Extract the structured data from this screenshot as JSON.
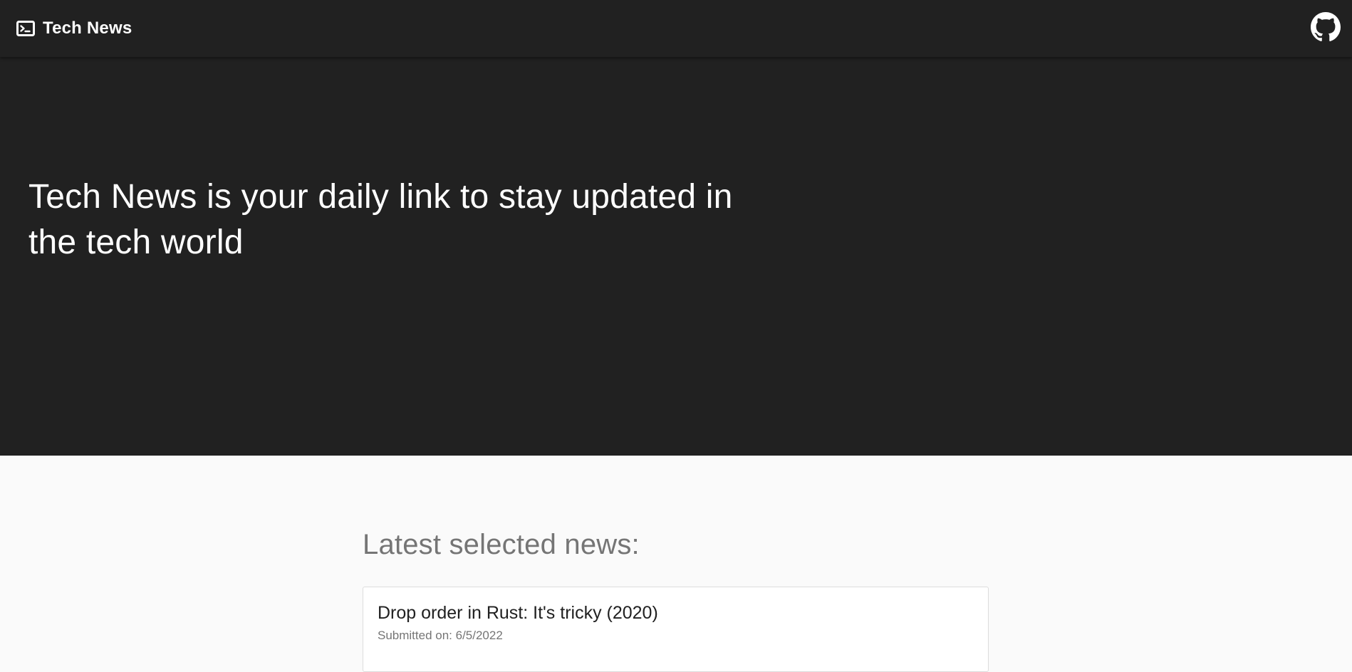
{
  "header": {
    "brand_icon": "terminal-icon",
    "title": "Tech News",
    "github_icon": "github-icon"
  },
  "hero": {
    "text": "Tech News is your daily link to stay updated in the tech world"
  },
  "news": {
    "section_title": "Latest selected news:",
    "items": [
      {
        "title": "Drop order in Rust: It's tricky (2020)",
        "submitted": "Submitted on: 6/5/2022"
      }
    ]
  },
  "colors": {
    "header_bg": "#212121",
    "hero_bg": "#212121",
    "page_bg": "#fafafa",
    "muted_text": "#757575"
  }
}
